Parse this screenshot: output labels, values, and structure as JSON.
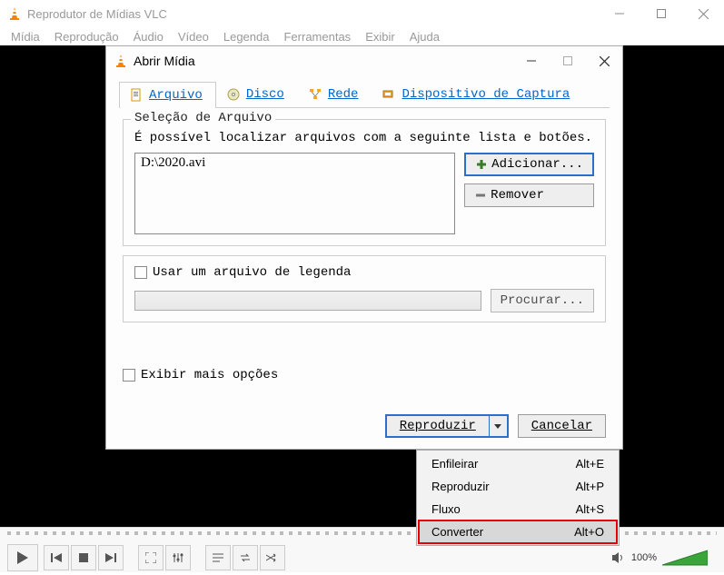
{
  "main": {
    "title": "Reprodutor de Mídias VLC",
    "menu": [
      "Mídia",
      "Reprodução",
      "Áudio",
      "Vídeo",
      "Legenda",
      "Ferramentas",
      "Exibir",
      "Ajuda"
    ]
  },
  "dialog": {
    "title": "Abrir Mídia",
    "tabs": {
      "file": "Arquivo",
      "disc": "Disco",
      "network": "Rede",
      "capture": "Dispositivo de Captura"
    },
    "file_section": {
      "legend": "Seleção de Arquivo",
      "help": "É possível localizar arquivos com a seguinte lista e botões.",
      "files": [
        "D:\\2020.avi"
      ],
      "add_btn": "Adicionar...",
      "remove_btn": "Remover"
    },
    "subtitle": {
      "checkbox_label": "Usar um arquivo de legenda",
      "browse_btn": "Procurar..."
    },
    "more_options": "Exibir mais opções",
    "play_btn": "Reproduzir",
    "cancel_btn": "Cancelar"
  },
  "dropdown": {
    "items": [
      {
        "label": "Enfileirar",
        "shortcut": "Alt+E"
      },
      {
        "label": "Reproduzir",
        "shortcut": "Alt+P"
      },
      {
        "label": "Fluxo",
        "shortcut": "Alt+S"
      },
      {
        "label": "Converter",
        "shortcut": "Alt+O",
        "highlight": true
      }
    ]
  },
  "controls": {
    "volume_pct": "100%"
  }
}
